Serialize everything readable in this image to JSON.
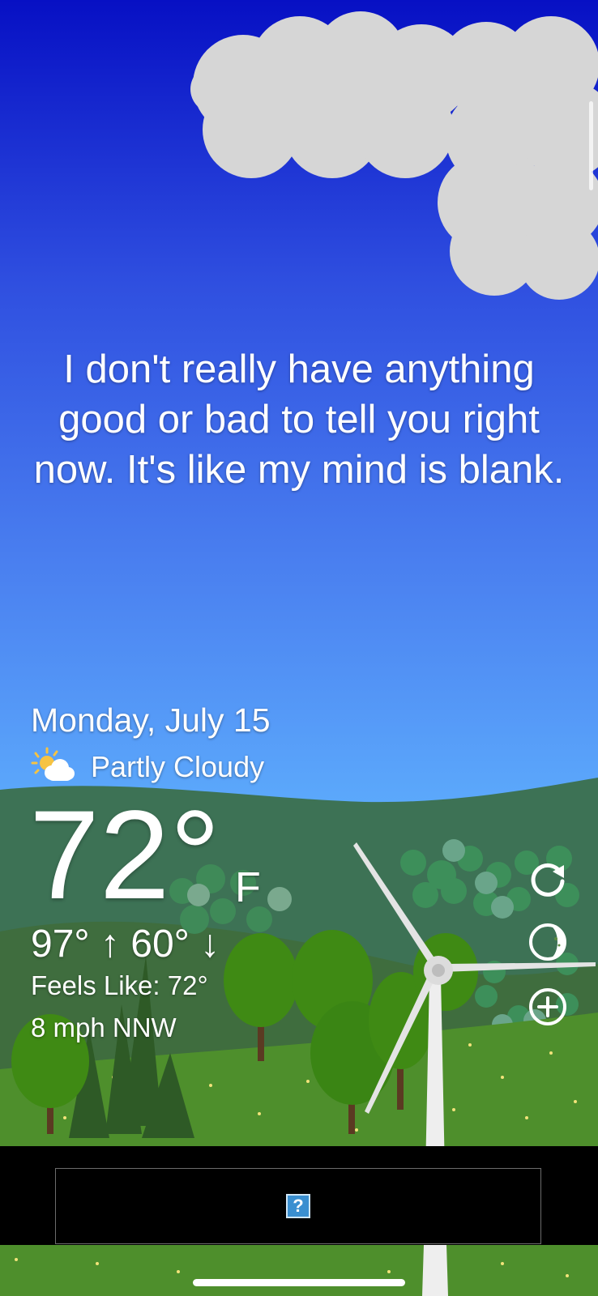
{
  "message": "I don't really have anything good or bad to tell you right now. It's like my mind is blank.",
  "weather": {
    "date": "Monday, July 15",
    "condition": "Partly Cloudy",
    "condition_icon": "partly-cloudy-icon",
    "temperature": "72°",
    "unit": "F",
    "hilo": "97° ↑ 60° ↓",
    "feels_like": "Feels Like: 72°",
    "wind": "8 mph NNW"
  },
  "actions": [
    {
      "name": "refresh-icon"
    },
    {
      "name": "moon-phase-icon"
    },
    {
      "name": "add-location-icon"
    }
  ],
  "ad": {
    "placeholder_glyph": "?"
  },
  "colors": {
    "sky_top": "#0710c4",
    "sky_bottom": "#5fb0ff",
    "grass": "#4e8f2c",
    "text": "#ffffff"
  }
}
